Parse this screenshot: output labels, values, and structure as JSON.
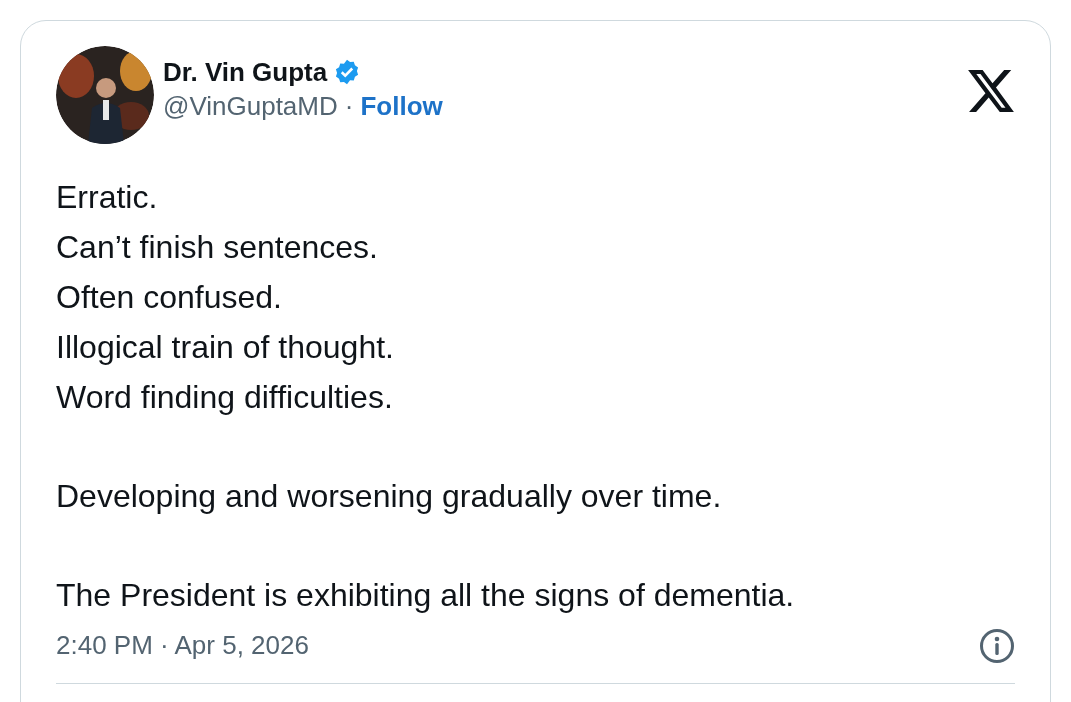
{
  "author": {
    "name": "Dr. Vin Gupta",
    "verified": true,
    "handle": "@VinGuptaMD",
    "separator": "·",
    "follow": "Follow"
  },
  "body": [
    [
      "Erratic.",
      "Can’t finish sentences.",
      "Often confused.",
      "Illogical train of thought.",
      "Word finding difficulties."
    ],
    [
      "Developing and worsening gradually over time."
    ],
    [
      "The President is exhibiting all the signs of dementia."
    ]
  ],
  "timestamp": "2:40 PM · Apr 5, 2026"
}
